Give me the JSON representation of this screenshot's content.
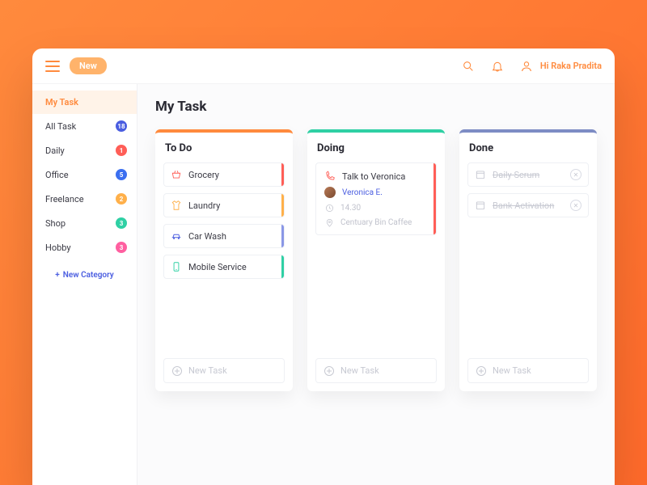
{
  "topbar": {
    "new_label": "New",
    "greeting": "Hi Raka Pradita"
  },
  "sidebar": {
    "items": [
      {
        "label": "My Task",
        "badge": "",
        "badge_color": "",
        "active": true
      },
      {
        "label": "All Task",
        "badge": "18",
        "badge_color": "#4a5de0",
        "active": false
      },
      {
        "label": "Daily",
        "badge": "1",
        "badge_color": "#ff5e57",
        "active": false
      },
      {
        "label": "Office",
        "badge": "5",
        "badge_color": "#3b6ff0",
        "active": false
      },
      {
        "label": "Freelance",
        "badge": "2",
        "badge_color": "#ffb04a",
        "active": false
      },
      {
        "label": "Shop",
        "badge": "3",
        "badge_color": "#2fd0a4",
        "active": false
      },
      {
        "label": "Hobby",
        "badge": "3",
        "badge_color": "#ff5fa0",
        "active": false
      }
    ],
    "new_category_label": "New Category"
  },
  "page": {
    "title": "My Task"
  },
  "board": {
    "columns": [
      {
        "key": "todo",
        "title": "To Do",
        "new_task_label": "New Task",
        "tasks": [
          {
            "label": "Grocery",
            "icon": "basket-icon",
            "icon_color": "#ff5e57",
            "stripe": "#ff5e57"
          },
          {
            "label": "Laundry",
            "icon": "shirt-icon",
            "icon_color": "#ffb04a",
            "stripe": "#ffb04a"
          },
          {
            "label": "Car Wash",
            "icon": "car-icon",
            "icon_color": "#4a5de0",
            "stripe": "#8a97e6"
          },
          {
            "label": "Mobile Service",
            "icon": "phone-icon",
            "icon_color": "#2fd0a4",
            "stripe": "#2fd0a4"
          }
        ]
      },
      {
        "key": "doing",
        "title": "Doing",
        "new_task_label": "New Task",
        "tasks": [
          {
            "label": "Talk to Veronica",
            "icon": "call-icon",
            "icon_color": "#ff5e57",
            "stripe": "#ff5e57",
            "expanded": true,
            "assignee": "Veronica E.",
            "time": "14.30",
            "location": "Centuary Bin Caffee"
          }
        ]
      },
      {
        "key": "done",
        "title": "Done",
        "new_task_label": "New Task",
        "tasks": [
          {
            "label": "Daily Scrum",
            "icon": "calendar-icon",
            "done": true
          },
          {
            "label": "Bank Activation",
            "icon": "calendar-icon",
            "done": true
          }
        ]
      }
    ]
  }
}
